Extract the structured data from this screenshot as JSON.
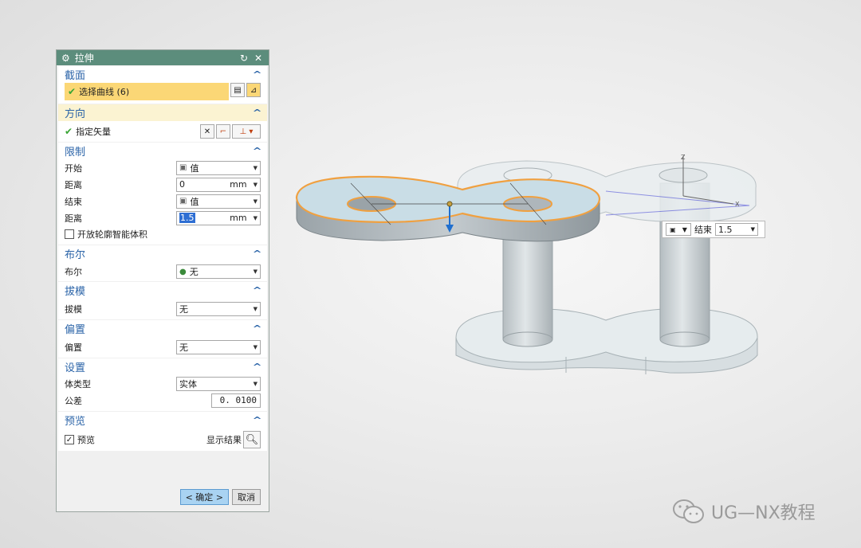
{
  "dialog": {
    "title": "拉伸",
    "sections": {
      "section": {
        "header": "截面",
        "select_curve": "选择曲线 (6)"
      },
      "direction": {
        "header": "方向",
        "vector_label": "指定矢量"
      },
      "limits": {
        "header": "限制",
        "start_label": "开始",
        "start_value": "值",
        "distance1_label": "距离",
        "distance1_value": "0",
        "distance1_unit": "mm",
        "end_label": "结束",
        "end_value": "值",
        "distance2_label": "距离",
        "distance2_value": "1.5",
        "distance2_unit": "mm",
        "open_profile_label": "开放轮廓智能体积"
      },
      "boolean": {
        "header": "布尔",
        "label": "布尔",
        "value": "无"
      },
      "draft": {
        "header": "拔模",
        "label": "拔模",
        "value": "无"
      },
      "offset": {
        "header": "偏置",
        "label": "偏置",
        "value": "无"
      },
      "settings": {
        "header": "设置",
        "body_type_label": "体类型",
        "body_type_value": "实体",
        "tolerance_label": "公差",
        "tolerance_value": "0. 0100"
      },
      "preview": {
        "header": "预览",
        "preview_label": "预览",
        "show_result_label": "显示结果"
      }
    },
    "buttons": {
      "ok": "< 确定 >",
      "cancel": "取消"
    }
  },
  "viewport": {
    "float_input": {
      "label": "结束",
      "value": "1.5"
    },
    "axis_labels": {
      "z": "Z",
      "x": "X"
    }
  },
  "watermark": {
    "text": "UG—NX教程"
  },
  "colors": {
    "title_bar": "#5c8d7c",
    "section_header": "#2b64a8",
    "highlight": "#fbd776",
    "selection_edge": "#f0a040"
  }
}
